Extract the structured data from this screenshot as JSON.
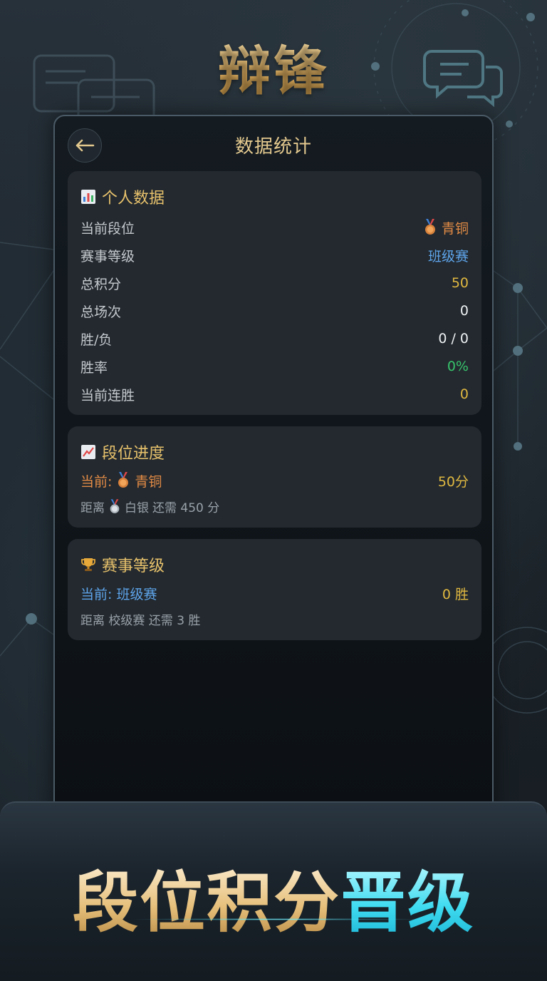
{
  "brand": "辩锋",
  "header": {
    "title": "数据统计",
    "back_icon": "arrow-left-icon"
  },
  "personal": {
    "title": "个人数据",
    "icon": "bar-chart-icon",
    "rows": [
      {
        "label": "当前段位",
        "value": "青铜",
        "icon": "bronze-medal-icon",
        "color": "#e38b45"
      },
      {
        "label": "赛事等级",
        "value": "班级赛",
        "color": "#5ea4ea"
      },
      {
        "label": "总积分",
        "value": "50",
        "color": "#e0b840"
      },
      {
        "label": "总场次",
        "value": "0",
        "color": "#eef1f3"
      },
      {
        "label": "胜/负",
        "value": "0 / 0",
        "color": "#eef1f3"
      },
      {
        "label": "胜率",
        "value": "0%",
        "color": "#37c46b"
      },
      {
        "label": "当前连胜",
        "value": "0",
        "color": "#e0b840"
      }
    ]
  },
  "rank_progress": {
    "title": "段位进度",
    "icon": "trend-chart-icon",
    "current_prefix": "当前:",
    "current_value": "青铜",
    "points": "50分",
    "next_prefix": "距离",
    "next_rank": "白银",
    "next_suffix": "还需 450 分"
  },
  "event_level": {
    "title": "赛事等级",
    "icon": "trophy-icon",
    "current": "当前: 班级赛",
    "wins": "0 胜",
    "next": "距离 校级赛 还需 3 胜"
  },
  "slogan": {
    "part1": "段位积分",
    "part2": "晋级"
  },
  "colors": {
    "gold": "#e0b840",
    "accent_cyan": "#3fdbf0",
    "blue": "#5ea4ea",
    "green": "#37c46b",
    "bronze": "#e38b45"
  }
}
